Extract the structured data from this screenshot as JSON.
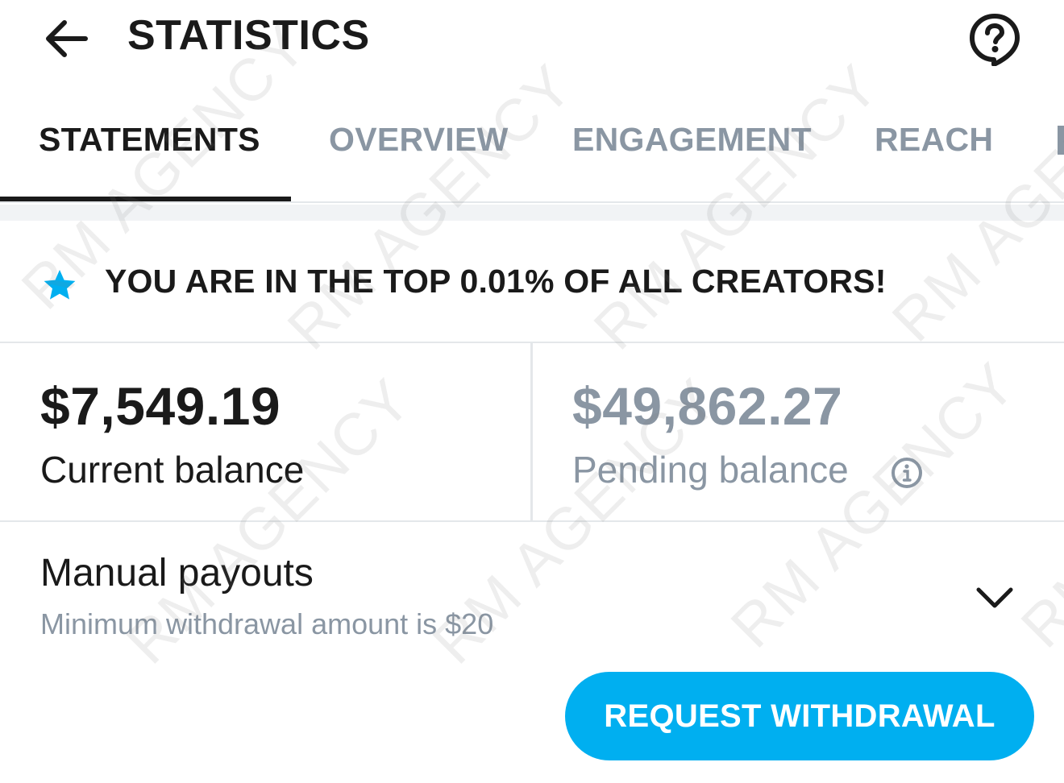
{
  "header": {
    "title": "STATISTICS",
    "back_icon": "arrow-left-icon",
    "help_icon": "help-bubble-icon"
  },
  "tabs": [
    {
      "label": "STATEMENTS",
      "active": true
    },
    {
      "label": "OVERVIEW",
      "active": false
    },
    {
      "label": "ENGAGEMENT",
      "active": false
    },
    {
      "label": "REACH",
      "active": false
    }
  ],
  "banner": {
    "icon": "star-icon",
    "text": "YOU ARE IN THE TOP 0.01% OF ALL CREATORS!"
  },
  "balances": {
    "current": {
      "amount": "$7,549.19",
      "label": "Current balance"
    },
    "pending": {
      "amount": "$49,862.27",
      "label": "Pending balance",
      "info_icon": "info-icon"
    }
  },
  "payouts": {
    "title": "Manual payouts",
    "subtitle": "Minimum withdrawal amount is $20",
    "expand_icon": "chevron-down-icon",
    "button_label": "REQUEST WITHDRAWAL"
  },
  "watermark": {
    "text": "RM AGENCY"
  },
  "colors": {
    "accent": "#00aff0",
    "text": "#1a1a1a",
    "muted": "#8a96a3",
    "divider": "#e4e7ea"
  }
}
